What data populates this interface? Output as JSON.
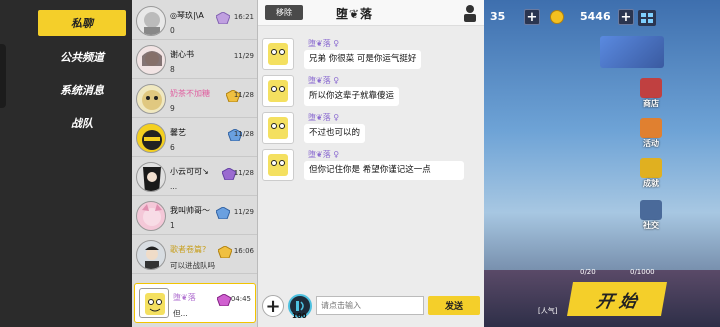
{
  "sidebar": {
    "tabs": [
      {
        "label": "私聊",
        "active": true
      },
      {
        "label": "公共频道",
        "active": false
      },
      {
        "label": "系统消息",
        "active": false
      },
      {
        "label": "战队",
        "active": false
      }
    ]
  },
  "friends": [
    {
      "name": "◎琴玖|\\A",
      "sub": "0",
      "date": "16:21",
      "name_color": "default"
    },
    {
      "name": "谢心书",
      "sub": "8",
      "date": "11/29",
      "name_color": "default"
    },
    {
      "name": "奶茶不加糖",
      "sub": "9",
      "date": "11/28",
      "name_color": "pink"
    },
    {
      "name": "馨艺",
      "sub": "6",
      "date": "11/28",
      "name_color": "default"
    },
    {
      "name": "小云可可↘",
      "sub": "...",
      "date": "11/28",
      "name_color": "default"
    },
    {
      "name": "我叫帅哥～",
      "sub": "1",
      "date": "11/29",
      "name_color": "default"
    },
    {
      "name": "歌者卷篇?",
      "sub": "可以进战队吗",
      "date": "16:06",
      "name_color": "gold"
    },
    {
      "name": "堕❦落",
      "sub": "但...",
      "date": "04:45",
      "name_color": "purple"
    }
  ],
  "chat": {
    "remove_label": "移除",
    "partner_name": "堕❦落",
    "messages": [
      {
        "sender": "堕❦落 ♀",
        "text": "兄弟 你很菜 可是你运气挺好"
      },
      {
        "sender": "堕❦落 ♀",
        "text": "所以你这辈子就靠傻运"
      },
      {
        "sender": "堕❦落 ♀",
        "text": "不过也可以的"
      },
      {
        "sender": "堕❦落 ♀",
        "text": "但你记住你是        希望你谨记这一点"
      }
    ],
    "input_placeholder": "请点击输入",
    "send_label": "发送",
    "voice_count": "100"
  },
  "hud": {
    "level_value": "35",
    "coin_value": "5446",
    "side_buttons": [
      "商店",
      "活动",
      "成就",
      "社交"
    ],
    "start_label": "开 始",
    "stat_a": "0/20",
    "stat_b": "0/1000",
    "popularity": "[人气]"
  },
  "colors": {
    "accent": "#f4cf2a",
    "sidebar": "#2b2b2b",
    "list_bg": "#dcdcdc",
    "chat_bg": "#ececec"
  }
}
